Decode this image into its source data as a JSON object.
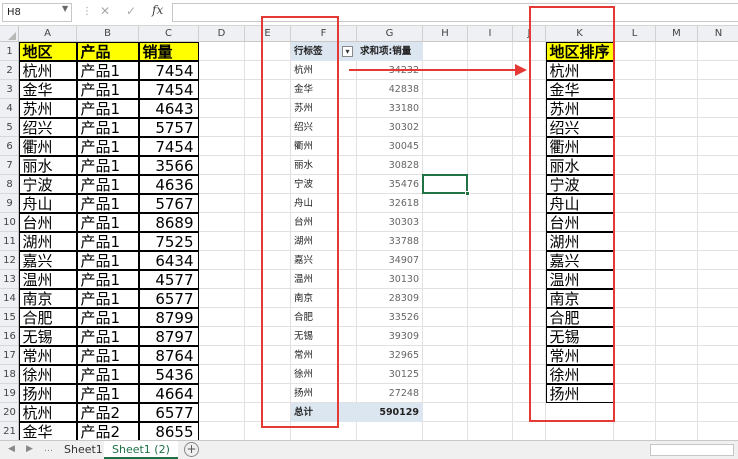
{
  "formula_bar": {
    "name_box": "H8",
    "fx": "fx",
    "content": ""
  },
  "columns": [
    "A",
    "B",
    "C",
    "D",
    "E",
    "F",
    "G",
    "H",
    "I",
    "J",
    "K",
    "L",
    "M",
    "N"
  ],
  "rows": [
    "1",
    "2",
    "3",
    "4",
    "5",
    "6",
    "7",
    "8",
    "9",
    "10",
    "11",
    "12",
    "13",
    "14",
    "15",
    "16",
    "17",
    "18",
    "19",
    "20",
    "21"
  ],
  "source_table": {
    "headers": [
      "地区",
      "产品",
      "销量"
    ],
    "rows": [
      [
        "杭州",
        "产品1",
        "7454"
      ],
      [
        "金华",
        "产品1",
        "7454"
      ],
      [
        "苏州",
        "产品1",
        "4643"
      ],
      [
        "绍兴",
        "产品1",
        "5757"
      ],
      [
        "衢州",
        "产品1",
        "7454"
      ],
      [
        "丽水",
        "产品1",
        "3566"
      ],
      [
        "宁波",
        "产品1",
        "4636"
      ],
      [
        "舟山",
        "产品1",
        "5767"
      ],
      [
        "台州",
        "产品1",
        "8689"
      ],
      [
        "湖州",
        "产品1",
        "7525"
      ],
      [
        "嘉兴",
        "产品1",
        "6434"
      ],
      [
        "温州",
        "产品1",
        "4577"
      ],
      [
        "南京",
        "产品1",
        "6577"
      ],
      [
        "合肥",
        "产品1",
        "8799"
      ],
      [
        "无锡",
        "产品1",
        "8797"
      ],
      [
        "常州",
        "产品1",
        "8764"
      ],
      [
        "徐州",
        "产品1",
        "5436"
      ],
      [
        "扬州",
        "产品1",
        "4664"
      ],
      [
        "杭州",
        "产品2",
        "6577"
      ],
      [
        "金华",
        "产品2",
        "8655"
      ]
    ]
  },
  "pivot": {
    "header_label": "行标签",
    "header_value": "求和项:销量",
    "rows": [
      [
        "杭州",
        "34232"
      ],
      [
        "金华",
        "42838"
      ],
      [
        "苏州",
        "33180"
      ],
      [
        "绍兴",
        "30302"
      ],
      [
        "衢州",
        "30045"
      ],
      [
        "丽水",
        "30828"
      ],
      [
        "宁波",
        "35476"
      ],
      [
        "舟山",
        "32618"
      ],
      [
        "台州",
        "30303"
      ],
      [
        "湖州",
        "33788"
      ],
      [
        "嘉兴",
        "34907"
      ],
      [
        "温州",
        "30130"
      ],
      [
        "南京",
        "28309"
      ],
      [
        "合肥",
        "33526"
      ],
      [
        "无锡",
        "39309"
      ],
      [
        "常州",
        "32965"
      ],
      [
        "徐州",
        "30125"
      ],
      [
        "扬州",
        "27248"
      ]
    ],
    "total_label": "总计",
    "total_value": "590129"
  },
  "region_order": {
    "header": "地区排序",
    "items": [
      "杭州",
      "金华",
      "苏州",
      "绍兴",
      "衢州",
      "丽水",
      "宁波",
      "舟山",
      "台州",
      "湖州",
      "嘉兴",
      "温州",
      "南京",
      "合肥",
      "无锡",
      "常州",
      "徐州",
      "扬州"
    ]
  },
  "sheet_tabs": [
    "Sheet1",
    "Sheet1 (2)"
  ],
  "colors": {
    "header_fill": "#ffff00",
    "pivot_header": "#dce6f1",
    "annotation": "#e53935",
    "selection": "#217346"
  }
}
